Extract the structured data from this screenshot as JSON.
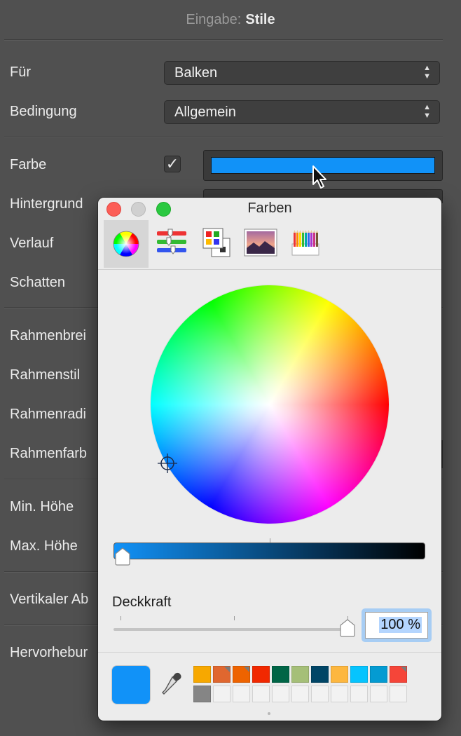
{
  "header": {
    "label": "Eingabe:",
    "value": "Stile"
  },
  "form": {
    "fuer": {
      "label": "Für",
      "value": "Balken"
    },
    "bedingung": {
      "label": "Bedingung",
      "value": "Allgemein"
    },
    "farbe": {
      "label": "Farbe",
      "checked": true,
      "color": "#1192f8"
    },
    "hintergrund": {
      "label": "Hintergrund"
    },
    "verlauf": {
      "label": "Verlauf"
    },
    "schatten": {
      "label": "Schatten"
    },
    "rahmenbreite": {
      "label": "Rahmenbrei"
    },
    "rahmenstil": {
      "label": "Rahmenstil"
    },
    "rahmenradius": {
      "label": "Rahmenradi"
    },
    "rahmenfarbe": {
      "label": "Rahmenfarb"
    },
    "min_hoehe": {
      "label": "Min. Höhe"
    },
    "max_hoehe": {
      "label": "Max. Höhe"
    },
    "vertikaler_abstand": {
      "label": "Vertikaler Ab"
    },
    "hervorhebung": {
      "label": "Hervorhebur"
    }
  },
  "color_panel": {
    "title": "Farben",
    "tabs": [
      {
        "name": "color-wheel",
        "selected": true
      },
      {
        "name": "color-sliders",
        "selected": false
      },
      {
        "name": "color-palettes",
        "selected": false
      },
      {
        "name": "image-palettes",
        "selected": false
      },
      {
        "name": "pencils",
        "selected": false
      }
    ],
    "current_color": "#1192f8",
    "brightness": 0.0,
    "opacity_label": "Deckkraft",
    "opacity_value": "100 %",
    "opacity_fraction": 1.0,
    "swatches_row1": [
      "#f7a800",
      "#e0672f",
      "#ee6300",
      "#f12800",
      "#006546",
      "#a5bf78",
      "#004566",
      "#fdb73f",
      "#06c4fe",
      "#049bd2",
      "#f54539"
    ],
    "swatches_row1_corner": [
      false,
      true,
      true,
      false,
      false,
      false,
      false,
      false,
      false,
      false,
      true
    ],
    "swatches_row2": [
      "#858585",
      "",
      "",
      "",
      "",
      "",
      "",
      "",
      "",
      "",
      ""
    ]
  }
}
